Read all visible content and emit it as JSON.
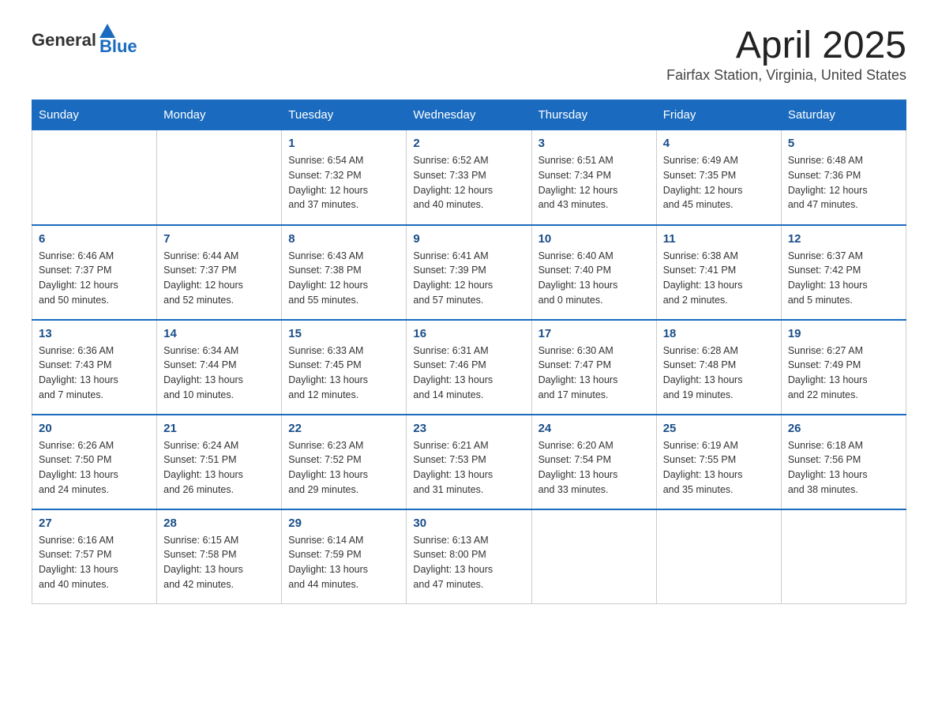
{
  "header": {
    "logo_general": "General",
    "logo_blue": "Blue",
    "title": "April 2025",
    "subtitle": "Fairfax Station, Virginia, United States"
  },
  "days_of_week": [
    "Sunday",
    "Monday",
    "Tuesday",
    "Wednesday",
    "Thursday",
    "Friday",
    "Saturday"
  ],
  "weeks": [
    [
      {
        "day": "",
        "info": ""
      },
      {
        "day": "",
        "info": ""
      },
      {
        "day": "1",
        "info": "Sunrise: 6:54 AM\nSunset: 7:32 PM\nDaylight: 12 hours\nand 37 minutes."
      },
      {
        "day": "2",
        "info": "Sunrise: 6:52 AM\nSunset: 7:33 PM\nDaylight: 12 hours\nand 40 minutes."
      },
      {
        "day": "3",
        "info": "Sunrise: 6:51 AM\nSunset: 7:34 PM\nDaylight: 12 hours\nand 43 minutes."
      },
      {
        "day": "4",
        "info": "Sunrise: 6:49 AM\nSunset: 7:35 PM\nDaylight: 12 hours\nand 45 minutes."
      },
      {
        "day": "5",
        "info": "Sunrise: 6:48 AM\nSunset: 7:36 PM\nDaylight: 12 hours\nand 47 minutes."
      }
    ],
    [
      {
        "day": "6",
        "info": "Sunrise: 6:46 AM\nSunset: 7:37 PM\nDaylight: 12 hours\nand 50 minutes."
      },
      {
        "day": "7",
        "info": "Sunrise: 6:44 AM\nSunset: 7:37 PM\nDaylight: 12 hours\nand 52 minutes."
      },
      {
        "day": "8",
        "info": "Sunrise: 6:43 AM\nSunset: 7:38 PM\nDaylight: 12 hours\nand 55 minutes."
      },
      {
        "day": "9",
        "info": "Sunrise: 6:41 AM\nSunset: 7:39 PM\nDaylight: 12 hours\nand 57 minutes."
      },
      {
        "day": "10",
        "info": "Sunrise: 6:40 AM\nSunset: 7:40 PM\nDaylight: 13 hours\nand 0 minutes."
      },
      {
        "day": "11",
        "info": "Sunrise: 6:38 AM\nSunset: 7:41 PM\nDaylight: 13 hours\nand 2 minutes."
      },
      {
        "day": "12",
        "info": "Sunrise: 6:37 AM\nSunset: 7:42 PM\nDaylight: 13 hours\nand 5 minutes."
      }
    ],
    [
      {
        "day": "13",
        "info": "Sunrise: 6:36 AM\nSunset: 7:43 PM\nDaylight: 13 hours\nand 7 minutes."
      },
      {
        "day": "14",
        "info": "Sunrise: 6:34 AM\nSunset: 7:44 PM\nDaylight: 13 hours\nand 10 minutes."
      },
      {
        "day": "15",
        "info": "Sunrise: 6:33 AM\nSunset: 7:45 PM\nDaylight: 13 hours\nand 12 minutes."
      },
      {
        "day": "16",
        "info": "Sunrise: 6:31 AM\nSunset: 7:46 PM\nDaylight: 13 hours\nand 14 minutes."
      },
      {
        "day": "17",
        "info": "Sunrise: 6:30 AM\nSunset: 7:47 PM\nDaylight: 13 hours\nand 17 minutes."
      },
      {
        "day": "18",
        "info": "Sunrise: 6:28 AM\nSunset: 7:48 PM\nDaylight: 13 hours\nand 19 minutes."
      },
      {
        "day": "19",
        "info": "Sunrise: 6:27 AM\nSunset: 7:49 PM\nDaylight: 13 hours\nand 22 minutes."
      }
    ],
    [
      {
        "day": "20",
        "info": "Sunrise: 6:26 AM\nSunset: 7:50 PM\nDaylight: 13 hours\nand 24 minutes."
      },
      {
        "day": "21",
        "info": "Sunrise: 6:24 AM\nSunset: 7:51 PM\nDaylight: 13 hours\nand 26 minutes."
      },
      {
        "day": "22",
        "info": "Sunrise: 6:23 AM\nSunset: 7:52 PM\nDaylight: 13 hours\nand 29 minutes."
      },
      {
        "day": "23",
        "info": "Sunrise: 6:21 AM\nSunset: 7:53 PM\nDaylight: 13 hours\nand 31 minutes."
      },
      {
        "day": "24",
        "info": "Sunrise: 6:20 AM\nSunset: 7:54 PM\nDaylight: 13 hours\nand 33 minutes."
      },
      {
        "day": "25",
        "info": "Sunrise: 6:19 AM\nSunset: 7:55 PM\nDaylight: 13 hours\nand 35 minutes."
      },
      {
        "day": "26",
        "info": "Sunrise: 6:18 AM\nSunset: 7:56 PM\nDaylight: 13 hours\nand 38 minutes."
      }
    ],
    [
      {
        "day": "27",
        "info": "Sunrise: 6:16 AM\nSunset: 7:57 PM\nDaylight: 13 hours\nand 40 minutes."
      },
      {
        "day": "28",
        "info": "Sunrise: 6:15 AM\nSunset: 7:58 PM\nDaylight: 13 hours\nand 42 minutes."
      },
      {
        "day": "29",
        "info": "Sunrise: 6:14 AM\nSunset: 7:59 PM\nDaylight: 13 hours\nand 44 minutes."
      },
      {
        "day": "30",
        "info": "Sunrise: 6:13 AM\nSunset: 8:00 PM\nDaylight: 13 hours\nand 47 minutes."
      },
      {
        "day": "",
        "info": ""
      },
      {
        "day": "",
        "info": ""
      },
      {
        "day": "",
        "info": ""
      }
    ]
  ]
}
